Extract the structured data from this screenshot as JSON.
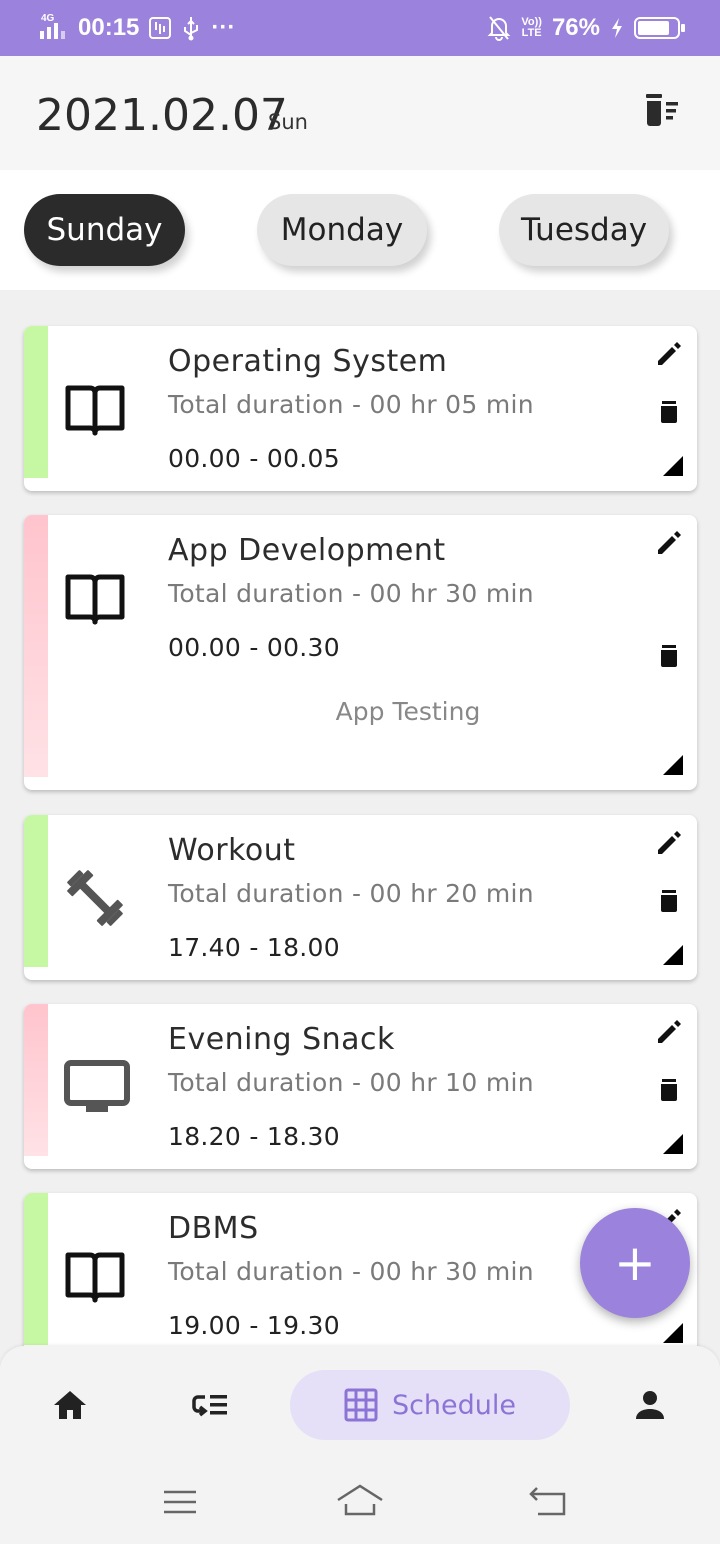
{
  "status_bar": {
    "network": "4G",
    "time": "00:15",
    "more": "···",
    "volte_top": "Vo))",
    "volte_bottom": "LTE",
    "battery": "76%"
  },
  "header": {
    "date": "2021.02.07",
    "weekday": "Sun",
    "clear_icon": "delete-sweep-icon"
  },
  "tabs": [
    {
      "label": "Sunday",
      "active": true
    },
    {
      "label": "Monday",
      "active": false
    },
    {
      "label": "Tuesday",
      "active": false
    }
  ],
  "schedule": [
    {
      "title": "Operating System",
      "duration": "Total duration - 00 hr 05 min",
      "time": "00.00 - 00.05",
      "icon": "book-icon",
      "stripe": "#c6f7a2"
    },
    {
      "title": "App Development",
      "duration": "Total duration - 00 hr 30 min",
      "time": "00.00 - 00.30",
      "note": "App Testing",
      "icon": "book-icon",
      "stripe": "#ffc9d2"
    },
    {
      "title": "Workout",
      "duration": "Total duration - 00 hr 20 min",
      "time": "17.40 - 18.00",
      "icon": "dumbbell-icon",
      "stripe": "#c6f7a2"
    },
    {
      "title": "Evening Snack",
      "duration": "Total duration - 00 hr 10 min",
      "time": "18.20 - 18.30",
      "icon": "monitor-icon",
      "stripe": "#ffc9d2"
    },
    {
      "title": "DBMS",
      "duration": "Total duration - 00 hr 30 min",
      "time": "19.00 - 19.30",
      "icon": "book-icon",
      "stripe": "#c6f7a2"
    }
  ],
  "fab": {
    "label": "+"
  },
  "bottom_nav": {
    "items": [
      "home-icon",
      "task-list-icon",
      "schedule-grid-icon",
      "profile-icon"
    ],
    "active_label": "Schedule"
  },
  "colors": {
    "accent": "#9b82dc",
    "active_tab": "#2b2b2b",
    "green_stripe": "#c6f7a2",
    "pink_stripe": "#ffc9d2"
  }
}
